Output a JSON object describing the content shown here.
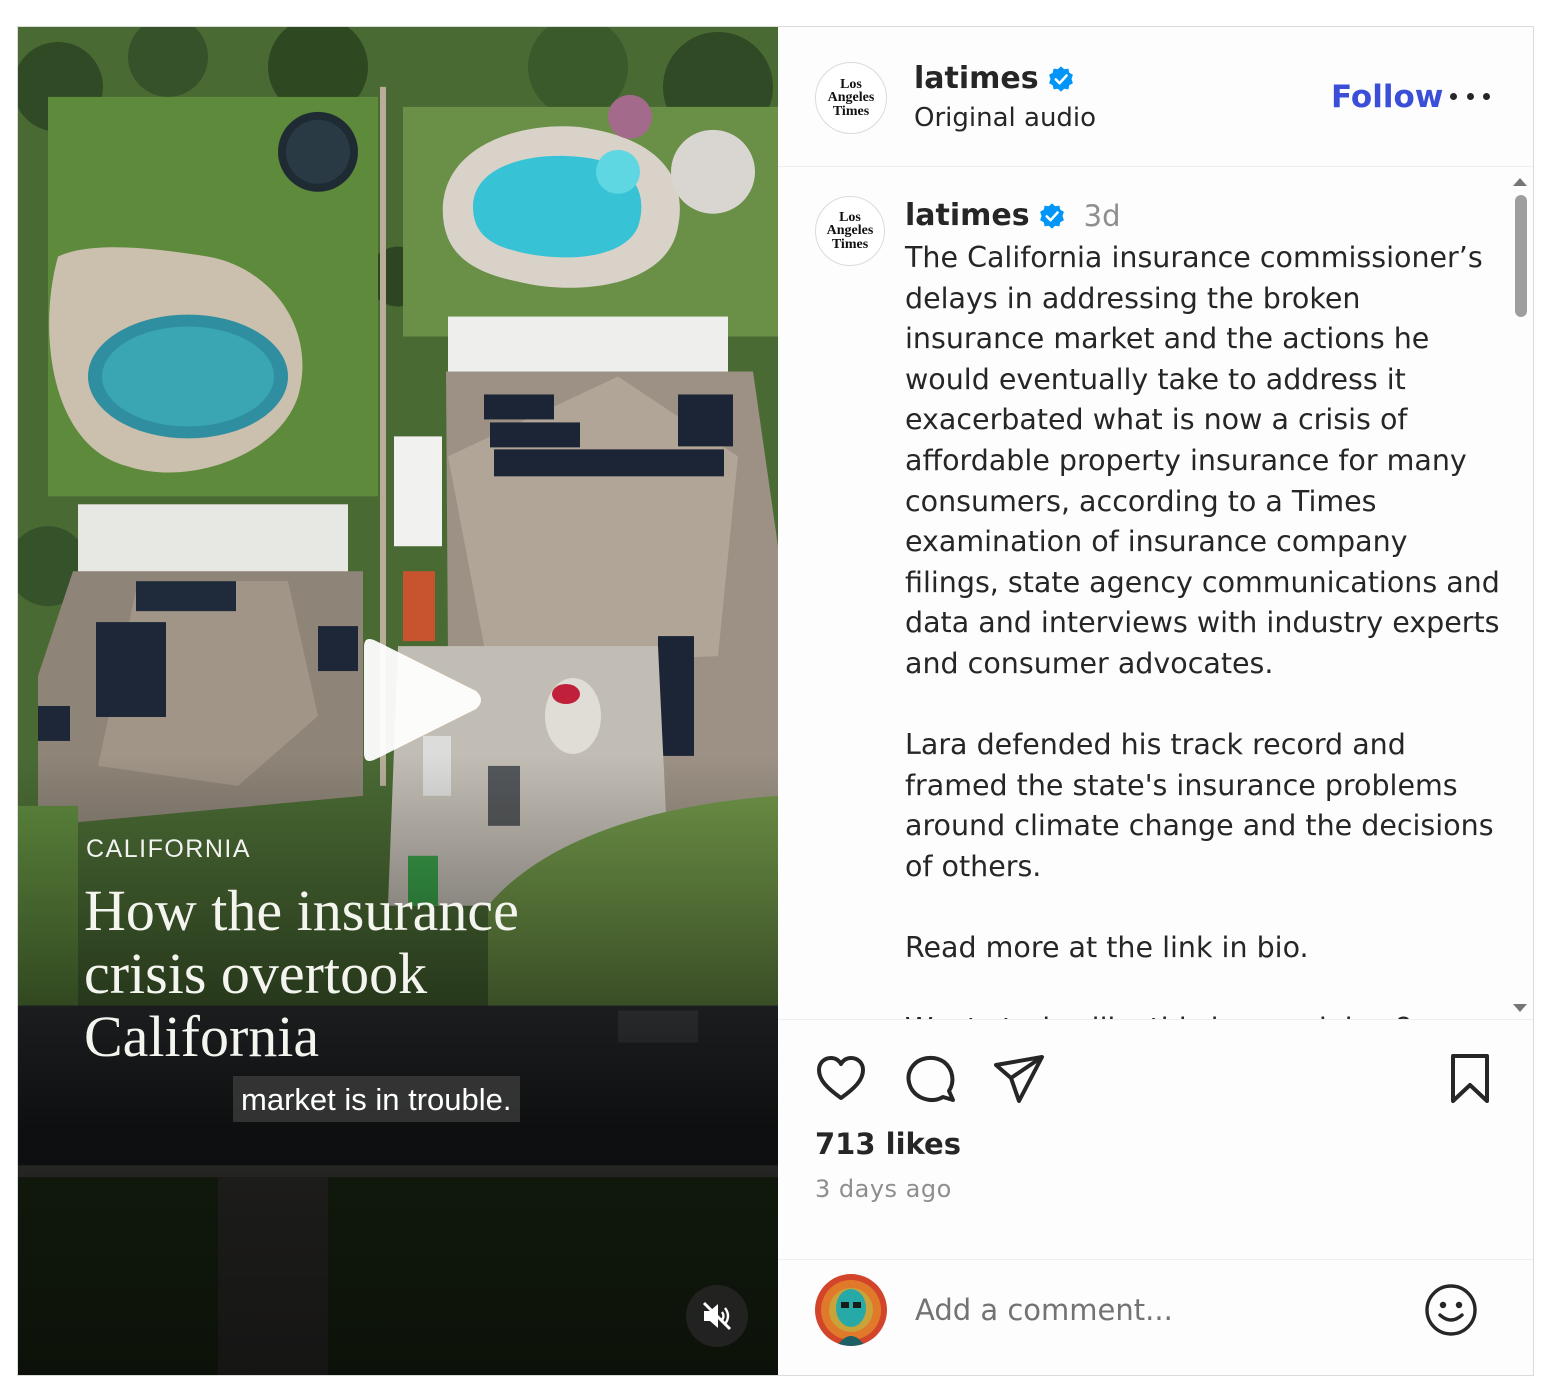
{
  "account": {
    "username": "latimes",
    "audio": "Original audio",
    "follow_label": "Follow",
    "logo_lines": [
      "Los",
      "Angeles",
      "Times"
    ]
  },
  "video": {
    "section": "CALIFORNIA",
    "title": "How the insurance\ncrisis overtook\nCalifornia",
    "subtitle": "market is in trouble.",
    "play_icon": "play-icon",
    "mute_icon": "muted-speaker-icon"
  },
  "caption": {
    "username": "latimes",
    "time": "3d",
    "text": "The California insurance commissioner’s delays in addressing the broken insurance market and the actions he would eventually take to address it exacerbated what is now a crisis of affordable property insurance for many consumers, according to a Times examination of insurance company filings, state agency communications and data and interviews with industry experts and consumer advocates.\n\nLara defended his track record and framed the state's insurance problems around climate change and the decisions of others.\n\nRead more at the link in bio.\n\nWant stories like this in your inbox?"
  },
  "actions": {
    "icons": [
      "heart-icon",
      "speech-bubble-icon",
      "paper-plane-icon",
      "bookmark-icon"
    ]
  },
  "stats": {
    "likes": "713 likes",
    "date": "3 days ago"
  },
  "comment": {
    "placeholder": "Add a comment...",
    "emoji_icon": "smiley-icon"
  },
  "colors": {
    "verified": "#0095f6",
    "follow": "#3b4ed8",
    "secondary_text": "#8e8e8e"
  }
}
